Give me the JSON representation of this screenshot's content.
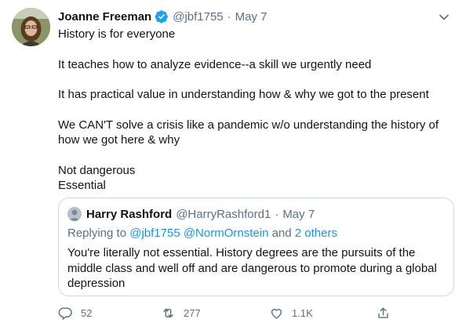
{
  "tweet": {
    "display_name": "Joanne Freeman",
    "handle": "@jbf1755",
    "separator": "·",
    "date": "May 7",
    "lines": [
      "History is for everyone",
      "It teaches how to analyze evidence--a skill we urgently need",
      "It has practical value in understanding how & why we got to the present",
      "We CAN'T solve a crisis like a pandemic w/o understanding the history of how we got here & why",
      "Not dangerous",
      "Essential"
    ]
  },
  "quote": {
    "display_name": "Harry Rashford",
    "handle": "@HarryRashford1",
    "separator": "·",
    "date": "May 7",
    "replying_prefix": "Replying to",
    "replying_users": "@jbf1755 @NormOrnstein",
    "replying_and": "and",
    "replying_others": "2 others",
    "text": "You're literally not essential. History degrees are the pursuits of the middle class and well off and are dangerous to promote during a global depression"
  },
  "actions": {
    "reply_count": "52",
    "retweet_count": "277",
    "like_count": "1.1K"
  },
  "colors": {
    "text": "#0f1419",
    "muted": "#5b7083",
    "link": "#1b95e0",
    "verified": "#1da1f2",
    "border": "#cfd9de"
  },
  "icons": [
    "caret-down-icon",
    "verified-badge-icon",
    "reply-icon",
    "retweet-icon",
    "like-icon",
    "share-icon"
  ]
}
